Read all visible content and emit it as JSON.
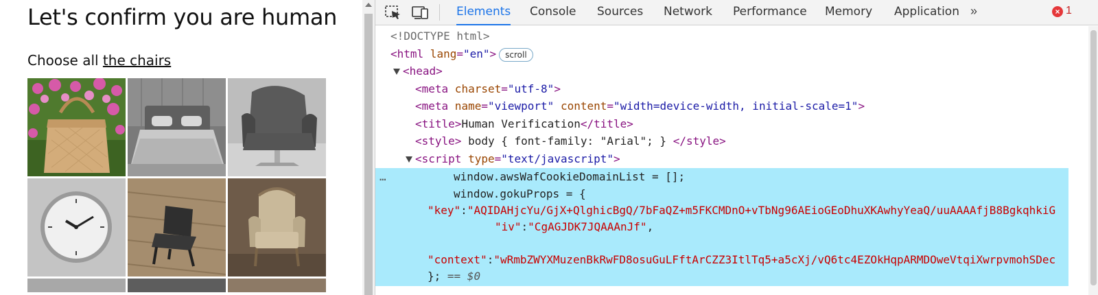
{
  "page": {
    "title": "Let's confirm you are human",
    "prompt_prefix": "Choose all ",
    "prompt_link": "the chairs",
    "tiles": [
      {
        "name": "tile-handbag"
      },
      {
        "name": "tile-bed"
      },
      {
        "name": "tile-armchair-grey"
      },
      {
        "name": "tile-clock"
      },
      {
        "name": "tile-chair-dark"
      },
      {
        "name": "tile-armchair-vintage"
      }
    ]
  },
  "devtools": {
    "tabs": [
      "Elements",
      "Console",
      "Sources",
      "Network",
      "Performance",
      "Memory",
      "Application"
    ],
    "active_tab": "Elements",
    "more_tabs_label": "»",
    "error_count": "1",
    "dom": {
      "doctype": "<!DOCTYPE html>",
      "html_open": "<html",
      "html_attr": " lang",
      "html_eq": "=",
      "html_val": "\"en\"",
      "html_close": ">",
      "scroll_badge": "scroll",
      "head_open": "<head>",
      "meta1_open": "<meta",
      "meta1_attr": " charset",
      "meta1_val": "\"utf-8\"",
      "meta2_attr1": " name",
      "meta2_val1": "\"viewport\"",
      "meta2_attr2": " content",
      "meta2_val2": "\"width=device-width, initial-scale=1\"",
      "title_open": "<title>",
      "title_text": "Human Verification",
      "title_close": "</title>",
      "style_open": "<style>",
      "style_text": " body { font-family: \"Arial\"; } ",
      "style_close": "</style>",
      "script_open": "<script",
      "script_attr": " type",
      "script_val": "\"text/javascript\"",
      "line_cookie": "window.awsWafCookieDomainList = [];",
      "line_goku": "window.gokuProps = {",
      "key_name": "\"key\"",
      "key_value": "\"AQIDAHjcYu/GjX+QlghicBgQ/7bFaQZ+m5FKCMDnO+vTbNg96AEioGEoDhuXKAwhyYeaQ/uuAAAAfjB8BgkqhkiG",
      "iv_name": "\"iv\"",
      "iv_value": "\"CgAGJDK7JQAAAnJf\"",
      "context_name": "\"context\"",
      "context_value": "\"wRmbZWYXMuzenBkRwFD8osuGuLFftArCZZ3ItlTq5+a5cXj/vQ6tc4EZOkHqpARMDOweVtqiXwrpvmohSDec",
      "close_brace": "};",
      "dollar_ref": "== $0",
      "ellipsis": "…"
    }
  }
}
